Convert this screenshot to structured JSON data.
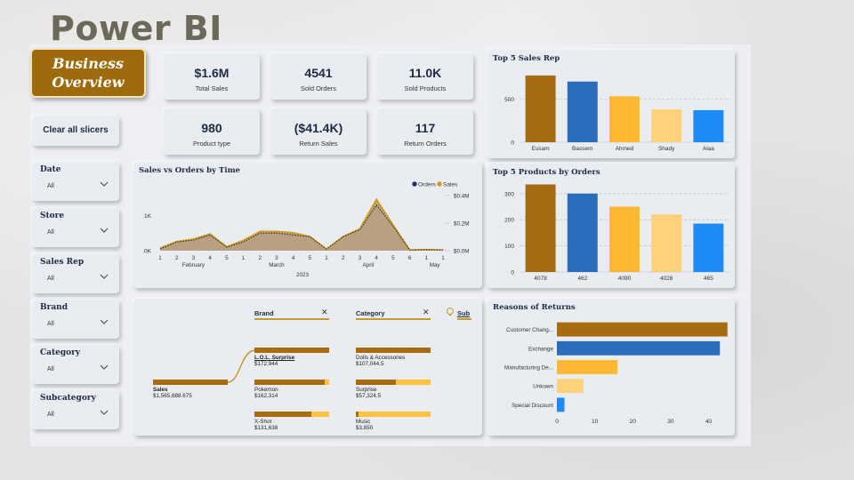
{
  "slide_title": "Power BI",
  "logo": {
    "line1": "Business",
    "line2": "Overview"
  },
  "kpis": [
    {
      "value": "$1.6M",
      "label": "Total Sales"
    },
    {
      "value": "4541",
      "label": "Sold Orders"
    },
    {
      "value": "11.0K",
      "label": "Sold Products"
    },
    {
      "value": "980",
      "label": "Product type"
    },
    {
      "value": "($41.4K)",
      "label": "Return Sales"
    },
    {
      "value": "117",
      "label": "Return Orders"
    }
  ],
  "clear_button": "Clear all slicers",
  "slicers": [
    {
      "title": "Date",
      "value": "All"
    },
    {
      "title": "Store",
      "value": "All"
    },
    {
      "title": "Sales Rep",
      "value": "All"
    },
    {
      "title": "Brand",
      "value": "All"
    },
    {
      "title": "Category",
      "value": "All"
    },
    {
      "title": "Subcategory",
      "value": "All"
    }
  ],
  "colors": {
    "dark_gold": "#a86c10",
    "blue": "#2a6ebb",
    "gold": "#ffb833",
    "light_gold": "#ffd17a",
    "bright_blue": "#1e8af5",
    "navy": "#1f2a44"
  },
  "decomp_tree": {
    "brand_header": "Brand",
    "category_header": "Category",
    "sub_header": "Sub",
    "close_icon": "✕",
    "root": {
      "name": "Sales",
      "value": "$1,565,688.675"
    },
    "brands": [
      {
        "name": "L.O.L. Surprise",
        "value": "$172,944",
        "fill": 1.0,
        "selected": true
      },
      {
        "name": "Pokemon",
        "value": "$162,314",
        "fill": 0.94,
        "selected": false
      },
      {
        "name": "X-Shot",
        "value": "$131,638",
        "fill": 0.76,
        "selected": false
      }
    ],
    "categories": [
      {
        "name": "Dolls & Accessories",
        "value": "$107,044.5",
        "fill": 1.0
      },
      {
        "name": "Surprise",
        "value": "$57,324.5",
        "fill": 0.54
      },
      {
        "name": "Music",
        "value": "$3,850",
        "fill": 0.04
      }
    ]
  },
  "chart_data": [
    {
      "type": "line",
      "title": "Sales vs Orders by Time",
      "legend": [
        "Orders",
        "Sales"
      ],
      "legend_position": "top-right",
      "x": [
        "1",
        "2",
        "3",
        "4",
        "5",
        "1",
        "2",
        "3",
        "4",
        "5",
        "1",
        "2",
        "3",
        "4",
        "5",
        "6",
        "1",
        "1"
      ],
      "x_groups": [
        {
          "label": "February",
          "start": 0,
          "end": 4
        },
        {
          "label": "March",
          "start": 5,
          "end": 9
        },
        {
          "label": "April",
          "start": 10,
          "end": 15
        },
        {
          "label": "May",
          "start": 16,
          "end": 17
        }
      ],
      "year_label": "2023",
      "y_left_ticks": [
        "0K",
        "1K"
      ],
      "y_right_ticks": [
        "$0.0M",
        "$0.2M",
        "$0.4M"
      ],
      "series": [
        {
          "name": "Orders",
          "values": [
            50,
            250,
            300,
            450,
            100,
            250,
            500,
            500,
            450,
            400,
            50,
            400,
            600,
            1300,
            700,
            20,
            30,
            20
          ]
        },
        {
          "name": "Sales",
          "values": [
            20000,
            70000,
            90000,
            130000,
            30000,
            80000,
            150000,
            150000,
            140000,
            110000,
            10000,
            110000,
            170000,
            400000,
            200000,
            5000,
            8000,
            5000
          ]
        }
      ]
    },
    {
      "type": "bar",
      "title": "Top 5 Sales Rep",
      "categories": [
        "Essam",
        "Bassem",
        "Ahmed",
        "Shady",
        "Alaa"
      ],
      "values": [
        770,
        700,
        530,
        380,
        370
      ],
      "y_ticks": [
        0,
        500
      ],
      "ylim": [
        0,
        800
      ]
    },
    {
      "type": "bar",
      "title": "Top 5 Products by Orders",
      "categories": [
        "4078",
        "462",
        "4090",
        "4028",
        "465"
      ],
      "values": [
        335,
        300,
        250,
        220,
        185
      ],
      "y_ticks": [
        0,
        100,
        200,
        300
      ],
      "ylim": [
        0,
        340
      ]
    },
    {
      "type": "bar",
      "orientation": "horizontal",
      "title": "Reasons of Returns",
      "categories": [
        "Customer Chang...",
        "Exchange",
        "Manufacturing De...",
        "Unkown",
        "Special Discount"
      ],
      "values": [
        45,
        43,
        16,
        7,
        2
      ],
      "x_ticks": [
        0,
        10,
        20,
        30,
        40
      ],
      "xlim": [
        0,
        46
      ]
    }
  ]
}
